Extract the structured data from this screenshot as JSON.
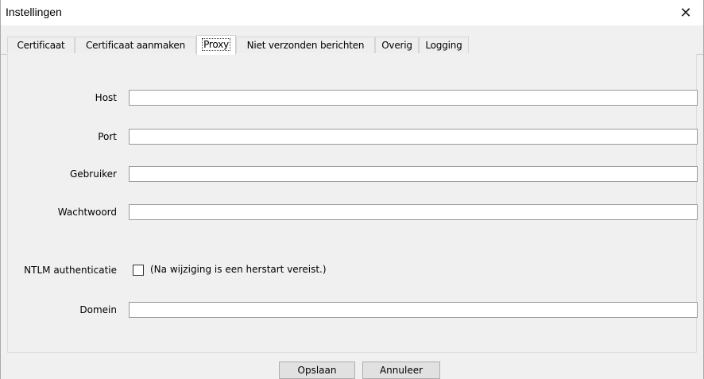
{
  "window": {
    "title": "Instellingen",
    "close_glyph": "✕"
  },
  "tabs": [
    {
      "label": "Certificaat",
      "active": false
    },
    {
      "label": "Certificaat aanmaken",
      "active": false
    },
    {
      "label": "Proxy",
      "active": true
    },
    {
      "label": "Niet verzonden berichten",
      "active": false
    },
    {
      "label": "Overig",
      "active": false
    },
    {
      "label": "Logging",
      "active": false
    }
  ],
  "form": {
    "host": {
      "label": "Host",
      "value": ""
    },
    "port": {
      "label": "Port",
      "value": ""
    },
    "user": {
      "label": "Gebruiker",
      "value": ""
    },
    "password": {
      "label": "Wachtwoord",
      "value": ""
    },
    "ntlm": {
      "label": "NTLM authenticatie",
      "checked": false,
      "note": "(Na wijziging is een herstart vereist.)"
    },
    "domain": {
      "label": "Domein",
      "value": ""
    }
  },
  "buttons": {
    "save": "Opslaan",
    "cancel": "Annuleer"
  }
}
